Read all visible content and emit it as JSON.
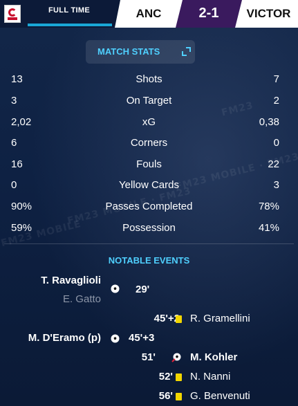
{
  "header": {
    "status": "FULL TIME",
    "home_team": "ANC",
    "score": "2-1",
    "away_team": "VICTOR",
    "colors": {
      "accent_bar": "#19a7d6",
      "score_bg": "#3a1a5e"
    }
  },
  "match_stats": {
    "title": "MATCH STATS",
    "rows": [
      {
        "label": "Shots",
        "home": "13",
        "away": "7"
      },
      {
        "label": "On Target",
        "home": "3",
        "away": "2"
      },
      {
        "label": "xG",
        "home": "2,02",
        "away": "0,38"
      },
      {
        "label": "Corners",
        "home": "6",
        "away": "0"
      },
      {
        "label": "Fouls",
        "home": "16",
        "away": "22"
      },
      {
        "label": "Yellow Cards",
        "home": "0",
        "away": "3"
      },
      {
        "label": "Passes Completed",
        "home": "90%",
        "away": "78%"
      },
      {
        "label": "Possession",
        "home": "59%",
        "away": "41%"
      }
    ]
  },
  "notable_events": {
    "title": "NOTABLE EVENTS",
    "events": [
      {
        "player": "T. Ravaglioli",
        "assist": "E. Gatto",
        "minute": "29'",
        "type": "goal",
        "side": "home"
      },
      {
        "player": "R. Gramellini",
        "minute": "45'+2",
        "type": "yellow-card",
        "side": "away"
      },
      {
        "player": "M. D'Eramo (p)",
        "minute": "45'+3",
        "type": "goal",
        "side": "home"
      },
      {
        "player": "M. Kohler",
        "minute": "51'",
        "type": "goal",
        "side": "away"
      },
      {
        "player": "N. Nanni",
        "minute": "52'",
        "type": "yellow-card",
        "side": "away"
      },
      {
        "player": "G. Benvenuti",
        "minute": "56'",
        "type": "yellow-card",
        "side": "away"
      }
    ]
  },
  "icons": [
    "club-badge-icon",
    "expand-icon",
    "football-icon",
    "yellow-card-icon"
  ]
}
